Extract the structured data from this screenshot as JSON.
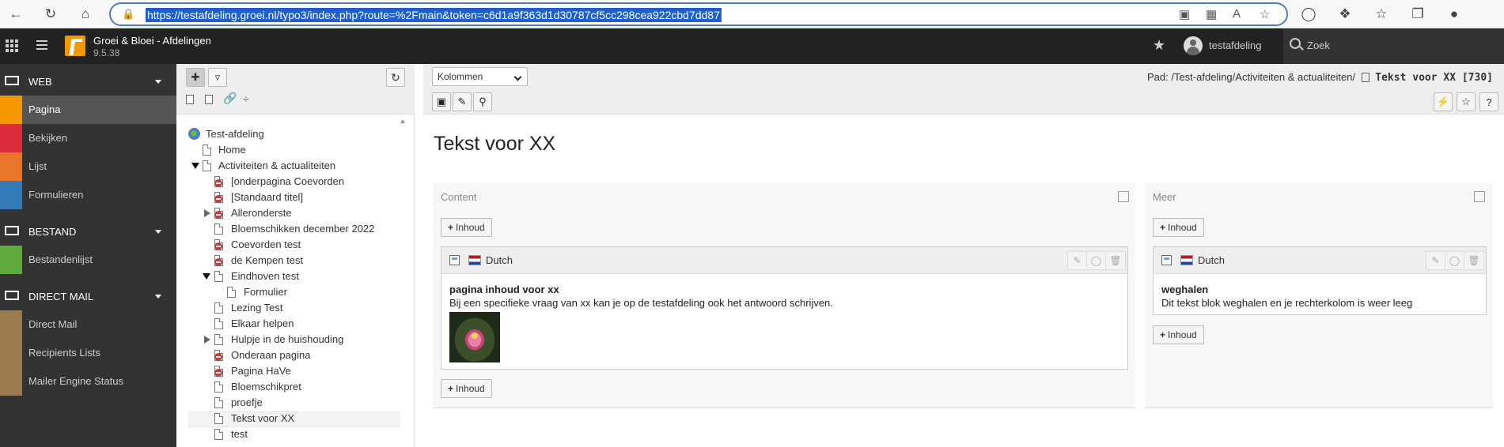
{
  "browser": {
    "url": "https://testafdeling.groei.nl/typo3/index.php?route=%2Fmain&token=c6d1a9f363d1d30787cf5cc298cea922cbd7dd87"
  },
  "topbar": {
    "site_name": "Groei & Bloei - Afdelingen",
    "version": "9.5.38",
    "username": "testafdeling",
    "search_label": "Zoek"
  },
  "modules": {
    "web": {
      "label": "WEB",
      "items": [
        {
          "label": "Pagina",
          "color": "#f49700"
        },
        {
          "label": "Bekijken",
          "color": "#dd2b3c"
        },
        {
          "label": "Lijst",
          "color": "#e9752b"
        },
        {
          "label": "Formulieren",
          "color": "#337ab7"
        }
      ]
    },
    "bestand": {
      "label": "BESTAND",
      "items": [
        {
          "label": "Bestandenlijst",
          "color": "#60a93b"
        }
      ]
    },
    "directmail": {
      "label": "DIRECT MAIL",
      "items": [
        {
          "label": "Direct Mail",
          "color": "#9b7c4f"
        },
        {
          "label": "Recipients Lists",
          "color": "#9b7c4f"
        },
        {
          "label": "Mailer Engine Status",
          "color": "#9b7c4f"
        }
      ]
    }
  },
  "tree": {
    "nodes": [
      {
        "label": "Test-afdeling"
      },
      {
        "label": "Home"
      },
      {
        "label": "Activiteiten & actualiteiten"
      },
      {
        "label": "[onderpagina Coevorden"
      },
      {
        "label": "[Standaard titel]"
      },
      {
        "label": "Alleronderste"
      },
      {
        "label": "Bloemschikken december 2022"
      },
      {
        "label": "Coevorden test"
      },
      {
        "label": "de Kempen test"
      },
      {
        "label": "Eindhoven test"
      },
      {
        "label": "Formulier"
      },
      {
        "label": "Lezing Test"
      },
      {
        "label": "Elkaar helpen"
      },
      {
        "label": "Hulpje in de huishouding"
      },
      {
        "label": "Onderaan pagina"
      },
      {
        "label": "Pagina HaVe"
      },
      {
        "label": "Bloemschikpret"
      },
      {
        "label": "proefje"
      },
      {
        "label": "Tekst voor XX"
      },
      {
        "label": "test"
      }
    ]
  },
  "docheader": {
    "view_select": "Kolommen",
    "path_prefix": "Pad: /Test-afdeling/Activiteiten & actualiteiten/",
    "current_page": "Tekst voor XX [730]"
  },
  "page": {
    "title": "Tekst voor XX",
    "columns": [
      {
        "name": "Content",
        "add_label": "Inhoud",
        "element": {
          "language": "Dutch",
          "header": "pagina inhoud voor xx",
          "bodytext": "Bij een specifieke vraag van xx kan je op de testafdeling ook het antwoord schrijven."
        }
      },
      {
        "name": "Meer",
        "add_label": "Inhoud",
        "element": {
          "language": "Dutch",
          "header": "weghalen",
          "bodytext": "Dit tekst blok weghalen en je rechterkolom is weer leeg"
        }
      }
    ]
  }
}
